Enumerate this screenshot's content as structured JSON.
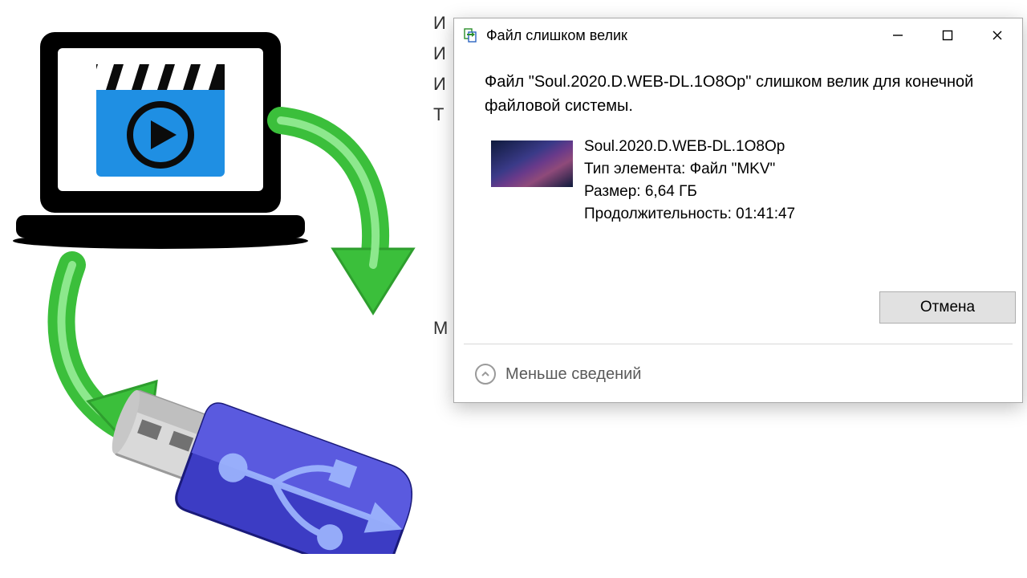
{
  "dialog": {
    "title": "Файл слишком велик",
    "message": "Файл \"Soul.2020.D.WEB-DL.1O8Op\" слишком велик для конечной файловой системы.",
    "file": {
      "name": "Soul.2020.D.WEB-DL.1O8Op",
      "type_label": "Тип элемента: Файл \"MKV\"",
      "size_label": "Размер: 6,64 ГБ",
      "duration_label": "Продолжительность: 01:41:47"
    },
    "cancel_label": "Отмена",
    "less_details_label": "Меньше сведений"
  },
  "bg_text": "И\nИ\nИ\nТ\n\n\n\n\n\n\nМ"
}
